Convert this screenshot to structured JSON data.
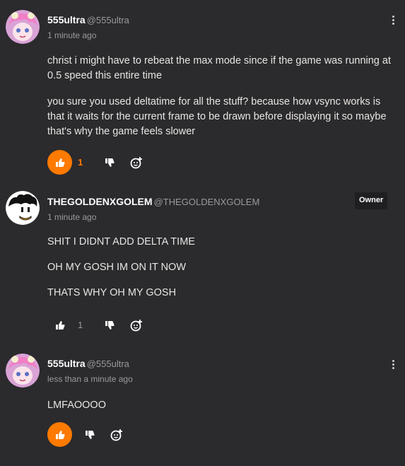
{
  "comments": [
    {
      "username": "555ultra",
      "handle": "@555ultra",
      "time": "1 minute ago",
      "paragraphs": [
        "christ i might have to rebeat the max mode since if the game was running at 0.5 speed this entire time",
        "you sure you used deltatime for all the stuff? because how vsync works is that it waits for the current frame to be drawn before displaying it so maybe that's why the game feels slower"
      ],
      "like_count": "1",
      "liked": true
    },
    {
      "username": "THEGOLDENXGOLEM",
      "handle": "@THEGOLDENXGOLEM",
      "badge": "Owner",
      "time": "1 minute ago",
      "paragraphs": [
        "SHIT I DIDNT ADD DELTA TIME",
        "OH MY GOSH IM ON IT NOW",
        "THATS WHY OH MY GOSH"
      ],
      "like_count": "1",
      "liked": false
    },
    {
      "username": "555ultra",
      "handle": "@555ultra",
      "time": "less than a minute ago",
      "paragraphs": [
        "LMFAOOOO"
      ],
      "like_count": "",
      "liked": true
    }
  ],
  "icons": {
    "like": "thumbs-up-icon",
    "dislike": "thumbs-down-icon",
    "react": "add-emoji-icon",
    "menu": "kebab-menu-icon"
  },
  "colors": {
    "background": "#2b2a2d",
    "accent": "#ff7a00",
    "text": "#e8e6e3",
    "muted": "#9a9a9d"
  }
}
